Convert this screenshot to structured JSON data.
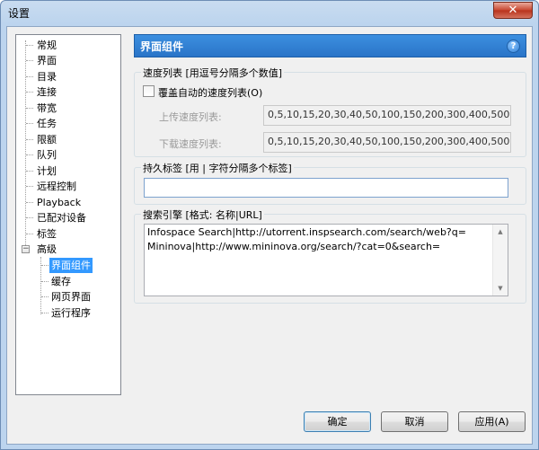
{
  "window": {
    "title": "设置",
    "close_glyph": "✕"
  },
  "tree": {
    "items": [
      {
        "label": "常规"
      },
      {
        "label": "界面"
      },
      {
        "label": "目录"
      },
      {
        "label": "连接"
      },
      {
        "label": "带宽"
      },
      {
        "label": "任务"
      },
      {
        "label": "限额"
      },
      {
        "label": "队列"
      },
      {
        "label": "计划"
      },
      {
        "label": "远程控制"
      },
      {
        "label": "Playback"
      },
      {
        "label": "已配对设备"
      },
      {
        "label": "标签"
      },
      {
        "label": "高级",
        "expanded": true
      },
      {
        "label": "界面组件",
        "selected": true
      },
      {
        "label": "缓存"
      },
      {
        "label": "网页界面"
      },
      {
        "label": "运行程序"
      }
    ],
    "expander_glyph": "−"
  },
  "panel": {
    "title": "界面组件",
    "help_glyph": "?"
  },
  "speed_list": {
    "group_title": "速度列表 [用逗号分隔多个数值]",
    "override_label": "覆盖自动的速度列表(O)",
    "override_checked": false,
    "upload_label": "上传速度列表:",
    "upload_value": "0,5,10,15,20,30,40,50,100,150,200,300,400,500",
    "download_label": "下载速度列表:",
    "download_value": "0,5,10,15,20,30,40,50,100,150,200,300,400,500"
  },
  "persistent_labels": {
    "group_title": "持久标签 [用 | 字符分隔多个标签]",
    "value": ""
  },
  "search_engines": {
    "group_title": "搜索引擎 [格式: 名称|URL]",
    "value": "Infospace Search|http://utorrent.inspsearch.com/search/web?q=\nMininova|http://www.mininova.org/search/?cat=0&search="
  },
  "buttons": {
    "ok": "确定",
    "cancel": "取消",
    "apply": "应用(A)"
  },
  "colors": {
    "selection": "#3399ff",
    "header": "#2a74c8"
  }
}
